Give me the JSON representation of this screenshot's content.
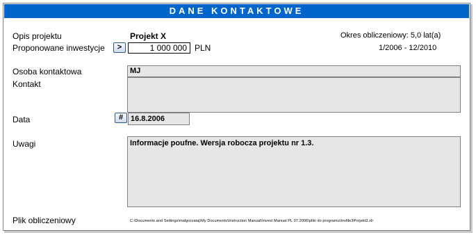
{
  "title": "DANE KONTAKTOWE",
  "project": {
    "description_label": "Opis projektu",
    "name": "Projekt X",
    "investment_label": "Proponowane inwestycje",
    "investment_button": ">",
    "investment_value": "1 000 000",
    "currency": "PLN",
    "period_label": "Okres obliczeniowy: 5,0 lat(a)",
    "period_range": "1/2006 - 12/2010"
  },
  "contact": {
    "person_label": "Osoba kontaktowa",
    "person_value": "MJ",
    "contact_label": "Kontakt",
    "contact_value": ""
  },
  "date": {
    "label": "Data",
    "button": "#",
    "value": "16.8.2006"
  },
  "notes": {
    "label": "Uwagi",
    "value": "Informacje poufne. Wersja robocza projektu nr 1.3."
  },
  "file": {
    "label": "Plik obliczeniowy",
    "path": "C:\\Documents and Settings\\malgorzataj\\My Documents\\Instruction Manual\\Invest Manual PL 07.2006\\pliki do programu\\Invfile3Projekt3.xlr"
  },
  "colors": {
    "title_bar": "#0066cc",
    "field_gray": "#e6e6e6"
  }
}
